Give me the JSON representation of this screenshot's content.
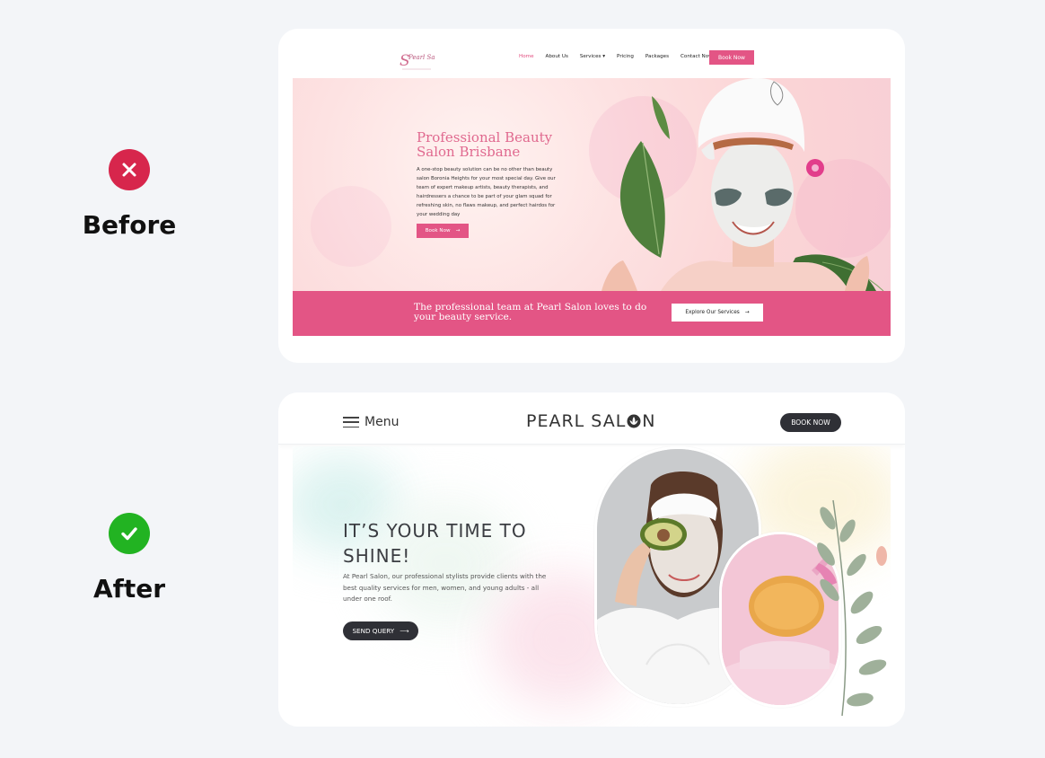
{
  "labels": {
    "before": "Before",
    "after": "After"
  },
  "status_icons": {
    "before": "cross-icon",
    "after": "check-icon"
  },
  "colors": {
    "bad": "#d7264c",
    "good": "#22b322",
    "pink_accent": "#e35585",
    "dark_button": "#2f3036"
  },
  "before": {
    "nav": {
      "logo_text": "Pearl Salon",
      "items": [
        "Home",
        "About Us",
        "Services",
        "Pricing",
        "Packages",
        "Contact Now"
      ],
      "book_label": "Book Now"
    },
    "hero": {
      "title": "Professional Beauty Salon Brisbane",
      "body": "A one-stop beauty solution can be no other than beauty salon Boronia Heights for your most special day. Give our team of expert makeup artists, beauty therapists, and hairdressers a chance to be part of your glam squad for refreshing skin, no flaws makeup, and perfect hairdos for your wedding day",
      "button": "Book Now"
    },
    "band": {
      "text": "The professional team at Pearl Salon loves to do your beauty service.",
      "button": "Explore Our Services"
    }
  },
  "after": {
    "nav": {
      "menu_label": "Menu",
      "brand_left": "PEARL SAL",
      "brand_right": "N",
      "book_label": "BOOK NOW"
    },
    "hero": {
      "title": "IT’S YOUR TIME TO SHINE!",
      "body": "At Pearl Salon, our professional stylists provide clients with the best quality services for men, women, and young adults - all under one roof.",
      "button": "SEND QUERY"
    }
  }
}
